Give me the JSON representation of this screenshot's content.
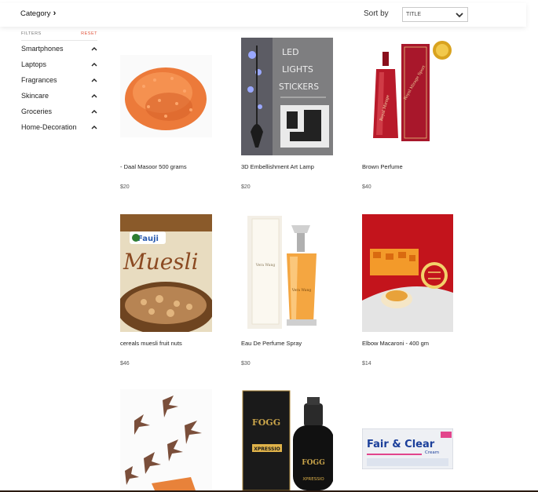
{
  "header": {
    "category_label": "Category",
    "sort_label": "Sort by",
    "sort_value": "TITLE"
  },
  "filters": {
    "title": "FILTERS",
    "reset": "RESET",
    "items": [
      {
        "label": "Smartphones"
      },
      {
        "label": "Laptops"
      },
      {
        "label": "Fragrances"
      },
      {
        "label": "Skincare"
      },
      {
        "label": "Groceries"
      },
      {
        "label": "Home-Decoration"
      }
    ]
  },
  "products": [
    {
      "name": "- Daal Masoor 500 grams",
      "price": "$20",
      "image": "lentils"
    },
    {
      "name": "3D Embellishment Art Lamp",
      "price": "$20",
      "image": "led-lamp",
      "image_text": [
        "LED",
        "LIGHTS",
        "STICKERS"
      ]
    },
    {
      "name": "Brown Perfume",
      "price": "$40",
      "image": "red-perfume",
      "image_text": [
        "Royal Mirage Sport"
      ]
    },
    {
      "name": "cereals muesli fruit nuts",
      "price": "$46",
      "image": "muesli",
      "image_text": [
        "Fauji",
        "Muesli"
      ]
    },
    {
      "name": "Eau De Perfume Spray",
      "price": "$30",
      "image": "gold-perfume"
    },
    {
      "name": "Elbow Macaroni - 400 gm",
      "price": "$14",
      "image": "macaroni"
    },
    {
      "name": "",
      "price": "",
      "image": "birds-decor"
    },
    {
      "name": "",
      "price": "",
      "image": "fogg-bottle",
      "image_text": [
        "FOGG",
        "XPRESSIO"
      ]
    },
    {
      "name": "",
      "price": "",
      "image": "fair-clear",
      "image_text": [
        "Fair & Clear",
        "Cream"
      ]
    }
  ],
  "colors": {
    "accent_reset": "#e0533b",
    "perfume_red": "#8c0f1c",
    "macaroni_red": "#c3141c"
  }
}
